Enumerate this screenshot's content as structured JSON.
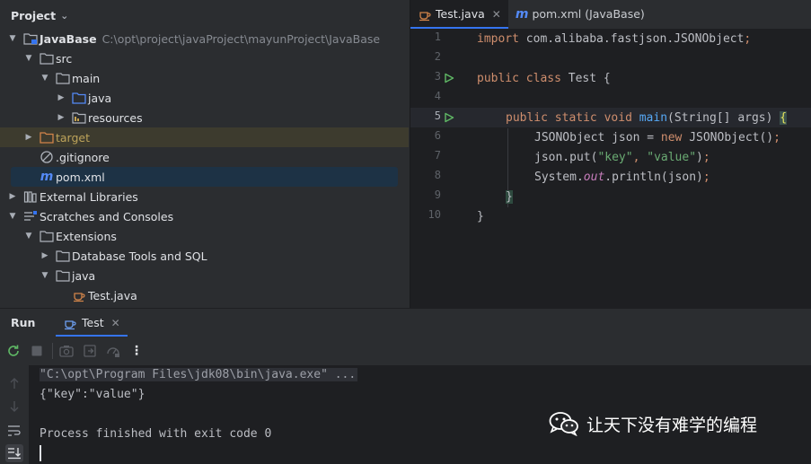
{
  "project": {
    "title": "Project",
    "tree": [
      {
        "label": "JavaBase",
        "path": "C:\\opt\\project\\javaProject\\mayunProject\\JavaBase",
        "arrow": "down",
        "icon": "module-folder-icon"
      },
      {
        "label": "src",
        "arrow": "down",
        "icon": "folder-icon"
      },
      {
        "label": "main",
        "arrow": "down",
        "icon": "folder-icon"
      },
      {
        "label": "java",
        "arrow": "right",
        "icon": "source-folder-icon"
      },
      {
        "label": "resources",
        "arrow": "right",
        "icon": "resources-folder-icon"
      },
      {
        "label": "target",
        "arrow": "right",
        "icon": "excluded-folder-icon"
      },
      {
        "label": ".gitignore",
        "arrow": "none",
        "icon": "ignore-file-icon"
      },
      {
        "label": "pom.xml",
        "arrow": "none",
        "icon": "maven-file-icon"
      },
      {
        "label": "External Libraries",
        "arrow": "right",
        "icon": "libraries-icon"
      },
      {
        "label": "Scratches and Consoles",
        "arrow": "down",
        "icon": "scratches-icon"
      },
      {
        "label": "Extensions",
        "arrow": "down",
        "icon": "folder-icon"
      },
      {
        "label": "Database Tools and SQL",
        "arrow": "right",
        "icon": "folder-icon"
      },
      {
        "label": "java",
        "arrow": "down",
        "icon": "folder-icon"
      },
      {
        "label": "Test.java",
        "arrow": "none",
        "icon": "java-file-icon"
      }
    ]
  },
  "editor": {
    "tabs": [
      {
        "label": "Test.java",
        "icon": "java-file-icon",
        "active": true
      },
      {
        "label": "pom.xml (JavaBase)",
        "icon": "maven-file-icon",
        "active": false
      }
    ],
    "line_numbers": [
      "1",
      "2",
      "3",
      "4",
      "5",
      "6",
      "7",
      "8",
      "9",
      "10"
    ],
    "code": {
      "l1": {
        "kw": "import",
        "rest": " com.alibaba.fastjson.JSONObject",
        "semi": ";"
      },
      "l3": {
        "kw1": "public",
        "kw2": "class",
        "rest": " Test {"
      },
      "l5": {
        "kw1": "public",
        "kw2": "static",
        "kw3": "void",
        "fn": "main",
        "rest": "(String[] args) ",
        "brace": "{"
      },
      "l6": {
        "a": "JSONObject json = ",
        "kw": "new",
        "b": " JSONObject()",
        "semi": ";"
      },
      "l7": {
        "a": "json.put(",
        "s1": "\"key\"",
        "comma": ", ",
        "s2": "\"value\"",
        "b": ")",
        "semi": ";"
      },
      "l8": {
        "a": "System.",
        "it": "out",
        "b": ".println(json)",
        "semi": ";"
      },
      "l9": {
        "brace": "}"
      },
      "l10": {
        "brace": "}"
      }
    }
  },
  "run": {
    "title": "Run",
    "tab_label": "Test",
    "console": {
      "cmd": "\"C:\\opt\\Program Files\\jdk08\\bin\\java.exe\" ...",
      "output": "{\"key\":\"value\"}",
      "finished": "Process finished with exit code 0"
    }
  },
  "watermark": {
    "text": "让天下没有难学的编程",
    "icon": "wechat-icon"
  }
}
